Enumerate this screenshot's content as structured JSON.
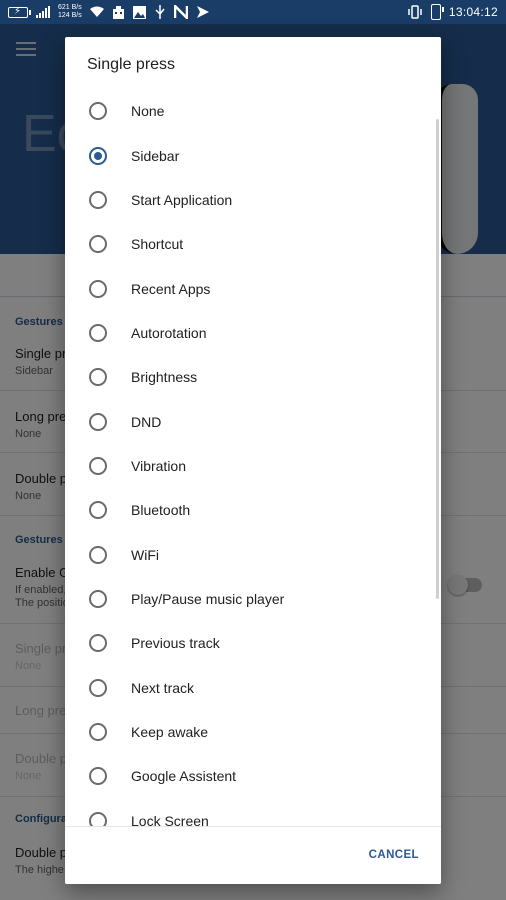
{
  "status_bar": {
    "net_up": "621 B/s",
    "net_down": "124 B/s",
    "time": "13:04:12",
    "icons": [
      "battery-charging-icon",
      "signal-icon",
      "wifi-icon",
      "building-icon",
      "image-icon",
      "usb-icon",
      "n-icon",
      "send-icon",
      "vibrate-icon",
      "battery-icon"
    ]
  },
  "background": {
    "title_fragment": "Ec",
    "sections": {
      "gestures": "Gestures",
      "gestures_in": "Gestures i",
      "configuration": "Configurat"
    },
    "rows": [
      {
        "title": "Single pr",
        "sub": "Sidebar"
      },
      {
        "title": "Long pre",
        "sub": "None"
      },
      {
        "title": "Double p",
        "sub": "None"
      },
      {
        "title": "Enable G",
        "sub": "If enabled,",
        "sub2": "The positio"
      },
      {
        "title": "Single pr",
        "sub": "None"
      },
      {
        "title": "Long pre",
        "sub": ""
      },
      {
        "title": "Double p",
        "sub": "None"
      },
      {
        "title": "Double p",
        "sub": "The highe"
      }
    ]
  },
  "dialog": {
    "title": "Single press",
    "selected_index": 1,
    "options": [
      "None",
      "Sidebar",
      "Start Application",
      "Shortcut",
      "Recent Apps",
      "Autorotation",
      "Brightness",
      "DND",
      "Vibration",
      "Bluetooth",
      "WiFi",
      "Play/Pause music player",
      "Previous track",
      "Next track",
      "Keep awake",
      "Google Assistent",
      "Lock Screen"
    ],
    "cancel_label": "CANCEL"
  },
  "colors": {
    "accent": "#2b5a94",
    "statusbar": "#1a3d68"
  }
}
